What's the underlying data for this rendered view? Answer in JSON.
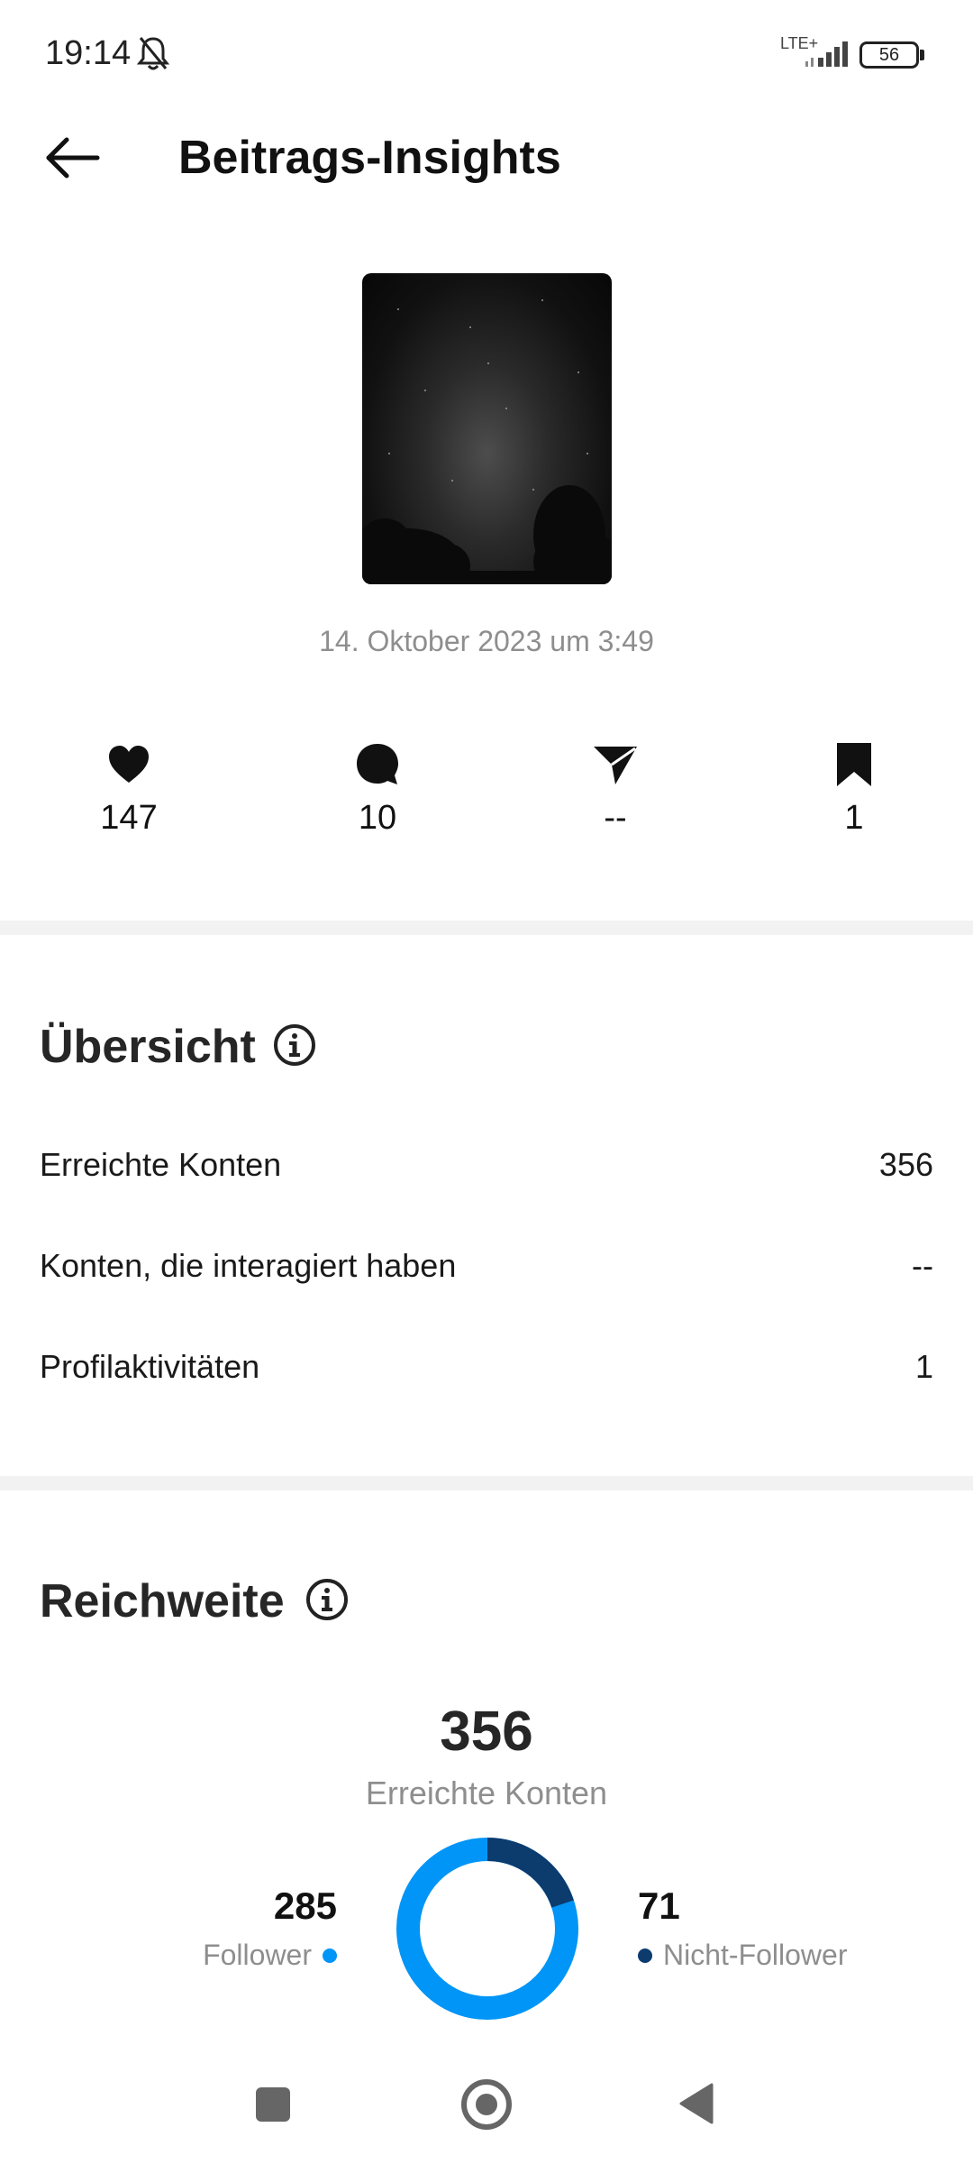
{
  "status_bar": {
    "time": "19:14",
    "network": "LTE+",
    "battery": "56",
    "icons": [
      "bell-off-icon",
      "signal-icon"
    ]
  },
  "header": {
    "title": "Beitrags-Insights",
    "back_icon": "arrow-left-icon"
  },
  "post": {
    "date": "14. Oktober 2023 um 3:49"
  },
  "metrics": [
    {
      "icon": "heart-icon",
      "value": "147"
    },
    {
      "icon": "comment-icon",
      "value": "10"
    },
    {
      "icon": "share-icon",
      "value": "--"
    },
    {
      "icon": "bookmark-icon",
      "value": "1"
    }
  ],
  "overview": {
    "title": "Übersicht",
    "rows": [
      {
        "label": "Erreichte Konten",
        "value": "356"
      },
      {
        "label": "Konten, die interagiert haben",
        "value": "--"
      },
      {
        "label": "Profilaktivitäten",
        "value": "1"
      }
    ]
  },
  "reach": {
    "title": "Reichweite",
    "total": "356",
    "total_label": "Erreichte Konten",
    "followers": {
      "value": "285",
      "label": "Follower",
      "color": "#0095f6"
    },
    "non_followers": {
      "value": "71",
      "label": "Nicht-Follower",
      "color": "#0c3b6e"
    }
  },
  "nav": {
    "icons": [
      "recent-apps-icon",
      "home-icon",
      "back-triangle-icon"
    ]
  }
}
